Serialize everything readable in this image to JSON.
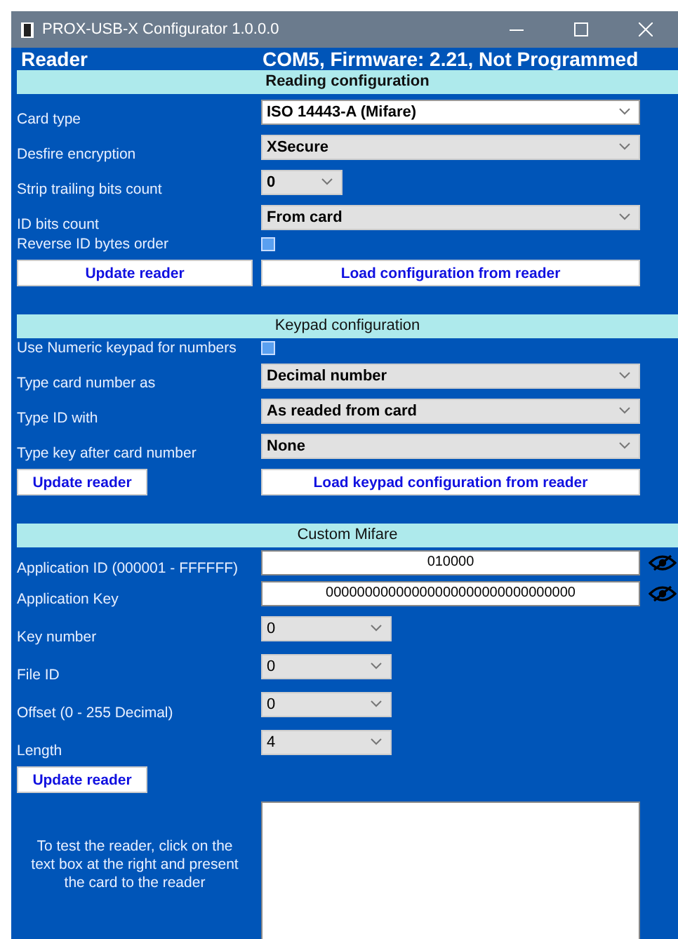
{
  "window": {
    "title": "PROX-USB-X Configurator  1.0.0.0"
  },
  "header": {
    "title": "Reader",
    "status": "COM5, Firmware: 2.21, Not Programmed"
  },
  "sections": [
    {
      "kind": "main",
      "title": "Reading configuration",
      "rows": [
        {
          "kind": "select",
          "label": "Card type",
          "value": "ISO 14443-A (Mifare)",
          "focused": true
        },
        {
          "kind": "select",
          "label": "Desfire encryption",
          "value": "XSecure",
          "focused": false
        },
        {
          "kind": "mini_select",
          "label": "Strip trailing bits count",
          "value": "0",
          "focused": false
        },
        {
          "kind": "select",
          "label": "ID bits count",
          "value": "From card",
          "focused": false
        },
        {
          "kind": "checkbox",
          "label": "Reverse ID bytes order",
          "checked": false
        }
      ],
      "buttons": [
        {
          "kind": "wide",
          "label": "Update reader"
        },
        {
          "kind": "wide",
          "label": "Load configuration from reader"
        }
      ]
    },
    {
      "kind": "bold_values",
      "title": "Keypad configuration",
      "rows": [
        {
          "kind": "checkbox",
          "label": "Use Numeric keypad for numbers",
          "checked": false
        },
        {
          "kind": "select",
          "label": "Type card number as",
          "value": "Decimal number",
          "focused": false
        },
        {
          "kind": "select",
          "label": "Type ID with",
          "value": "As readed from card",
          "focused": false
        },
        {
          "kind": "select",
          "label": "Type key after card number",
          "value": "None",
          "focused": false
        }
      ],
      "buttons": [
        {
          "kind": "short",
          "label": "Update reader"
        },
        {
          "kind": "wide",
          "label": "Load keypad configuration from reader"
        }
      ]
    },
    {
      "kind": "plain",
      "title": "Custom Mifare",
      "rows": [
        {
          "kind": "input",
          "label": "Application ID (000001 - FFFFFF)",
          "value": "010000"
        },
        {
          "kind": "input",
          "label": "Application Key",
          "value": "00000000000000000000000000000000"
        },
        {
          "kind": "short_select",
          "label": "Key number",
          "value": "0",
          "focused": false
        },
        {
          "kind": "short_select",
          "label": "File ID",
          "value": "0",
          "focused": false
        },
        {
          "kind": "short_select",
          "label": "Offset (0 - 255 Decimal)",
          "value": "0",
          "focused": false
        },
        {
          "kind": "short_select",
          "label": "Length",
          "value": "4",
          "focused": false
        }
      ],
      "buttons": [
        {
          "kind": "short",
          "label": "Update reader"
        }
      ]
    }
  ],
  "test": {
    "instructions": "To test the reader, click on the text box at the right and present the card to the reader"
  }
}
